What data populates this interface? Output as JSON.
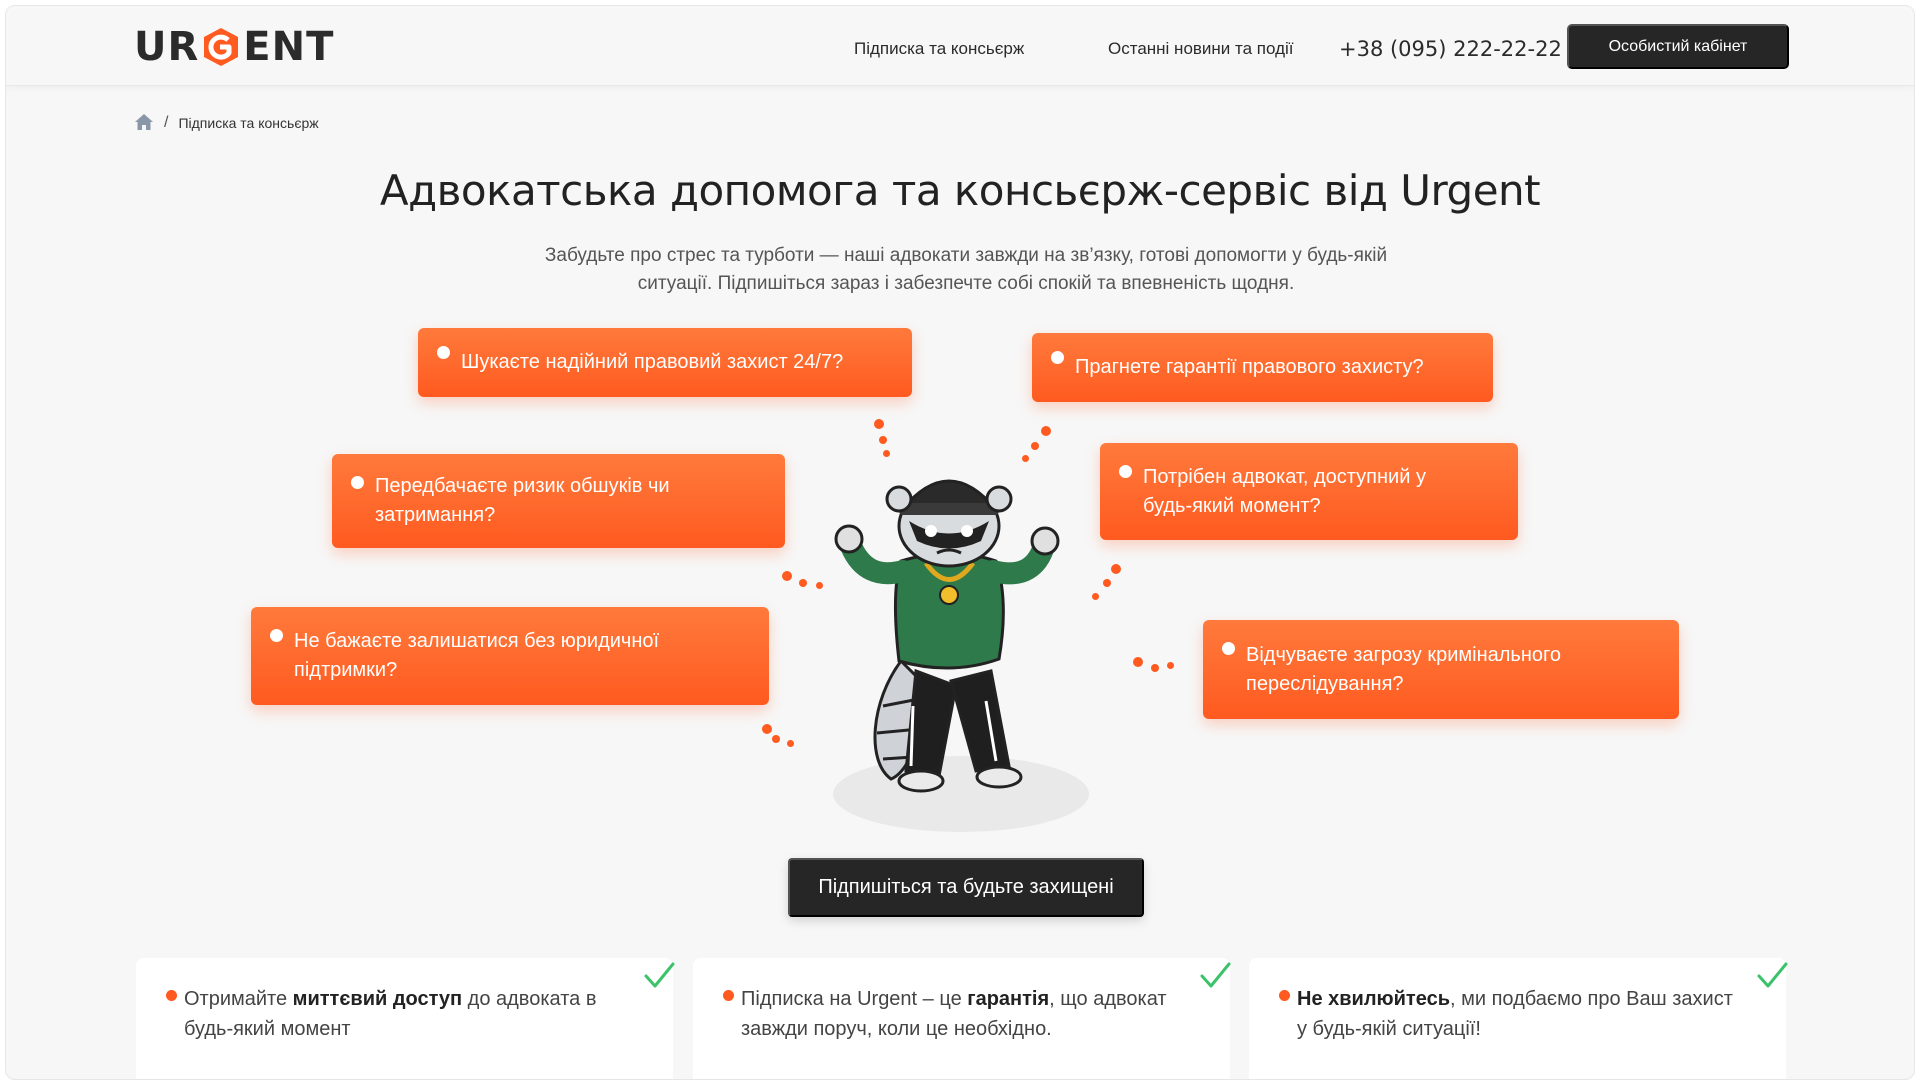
{
  "header": {
    "logo_text": {
      "before": "UR",
      "after": "ENT"
    },
    "nav": [
      {
        "label": "Підписка та консьєрж"
      },
      {
        "label": "Останні новини та події"
      }
    ],
    "phone": "+38 (095) 222-22-22",
    "cabinet_label": "Особистий кабінет"
  },
  "breadcrumb": {
    "home_icon": "home-icon",
    "separator": "/",
    "current": "Підписка та консьєрж"
  },
  "hero": {
    "title": "Адвокатська допомога та консьєрж-сервіс від Urgent",
    "subtitle_line1": "Забудьте про стрес та турботи — наші адвокати завжди на зв’язку, готові допомогти у будь-якій",
    "subtitle_line2": "ситуації. Підпишіться зараз і забезпечте собі спокій та впевненість щодня."
  },
  "bubbles": [
    {
      "line1": "Шукаєте надійний правовий захист 24/7?",
      "line2": ""
    },
    {
      "line1": "Прагнете гарантії правового захисту?",
      "line2": ""
    },
    {
      "line1": "Передбачаєте ризик обшуків чи",
      "line2": "затримання?"
    },
    {
      "line1": "Потрібен адвокат, доступний у",
      "line2": "будь-який момент?"
    },
    {
      "line1": "Не бажаєте залишатися без юридичної",
      "line2": "підтримки?"
    },
    {
      "line1": "Відчуваєте загрозу кримінального",
      "line2": "переслідування?"
    }
  ],
  "cta_label": "Підпишіться та будьте захищені",
  "cards": [
    {
      "pre": "Отримайте ",
      "bold": "миттєвий доступ",
      "post": " до адвоката в будь-який момент"
    },
    {
      "pre": "Підписка на Urgent – це ",
      "bold": "гарантія",
      "post": ", що адвокат завжди поруч, коли це необхідно."
    },
    {
      "pre": "",
      "bold": "Не хвилюйтесь",
      "post": ", ми подбаємо про Ваш захист у будь-якій ситуації!"
    }
  ],
  "colors": {
    "accent": "#ff5a1f",
    "dark": "#262626",
    "check": "#3cc26b",
    "background": "#f7f7f7"
  }
}
